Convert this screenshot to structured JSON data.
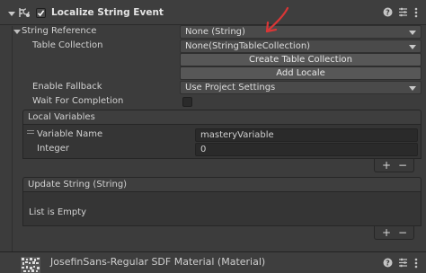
{
  "component": {
    "title": "Localize String Event",
    "enabled": true,
    "icons": [
      "help-icon",
      "preset-icon",
      "kebab-menu-icon"
    ]
  },
  "string_reference": {
    "label": "String Reference",
    "value": "None (String)",
    "table_collection_label": "Table Collection",
    "table_collection_value": "None(StringTableCollection)",
    "create_button": "Create Table Collection",
    "add_locale_button": "Add Locale",
    "enable_fallback_label": "Enable Fallback",
    "enable_fallback_value": "Use Project Settings",
    "wait_label": "Wait For Completion",
    "wait_checked": false
  },
  "local_variables": {
    "title": "Local Variables",
    "variable_name_label": "Variable Name",
    "variable_name_value": "masteryVariable",
    "integer_label": "Integer",
    "integer_value": "0"
  },
  "update_string": {
    "title": "Update String (String)",
    "empty_text": "List is Empty"
  },
  "material": {
    "title": "JosefinSans-Regular SDF Material (Material)"
  },
  "list_controls": {
    "add": "+",
    "remove": "−"
  },
  "colors": {
    "annotation_arrow": "#d93636",
    "window_bg": "#3c3c3c",
    "field_bg": "#2a2a2a"
  }
}
